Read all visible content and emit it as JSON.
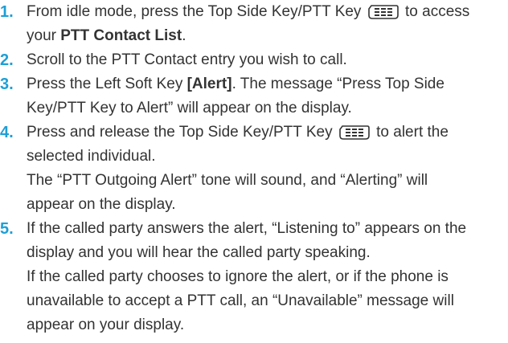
{
  "steps": [
    {
      "number": "1.",
      "p1a": "From idle mode, press the Top Side Key/PTT Key",
      "p1b": "to access",
      "p2a": "your",
      "p2b": "PTT Contact List",
      "p2c": "."
    },
    {
      "number": "2.",
      "text": "Scroll to the PTT Contact entry you wish to call."
    },
    {
      "number": "3.",
      "p1a": "Press the Left Soft Key",
      "p1b": "[Alert]",
      "p1c": ". The message “Press Top Side",
      "p2": "Key/PTT Key to Alert” will appear on the display."
    },
    {
      "number": "4.",
      "p1a": "Press and release the Top Side Key/PTT Key",
      "p1b": "to alert the",
      "p2": "selected individual.",
      "p3": "The “PTT Outgoing Alert” tone will sound, and “Alerting” will",
      "p4": "appear on the display."
    },
    {
      "number": "5.",
      "p1": "If the called party answers the alert, “Listening to” appears on the",
      "p2": "display and you will hear the called party speaking.",
      "p3": "If the called party chooses to ignore the alert, or if the phone is",
      "p4": "unavailable to accept a PTT call, an “Unavailable” message will",
      "p5": "appear on your display."
    }
  ],
  "icons": {
    "ptt_key": "side-key-icon"
  },
  "colors": {
    "step_number": "#1e9fd6",
    "text": "#333333"
  }
}
